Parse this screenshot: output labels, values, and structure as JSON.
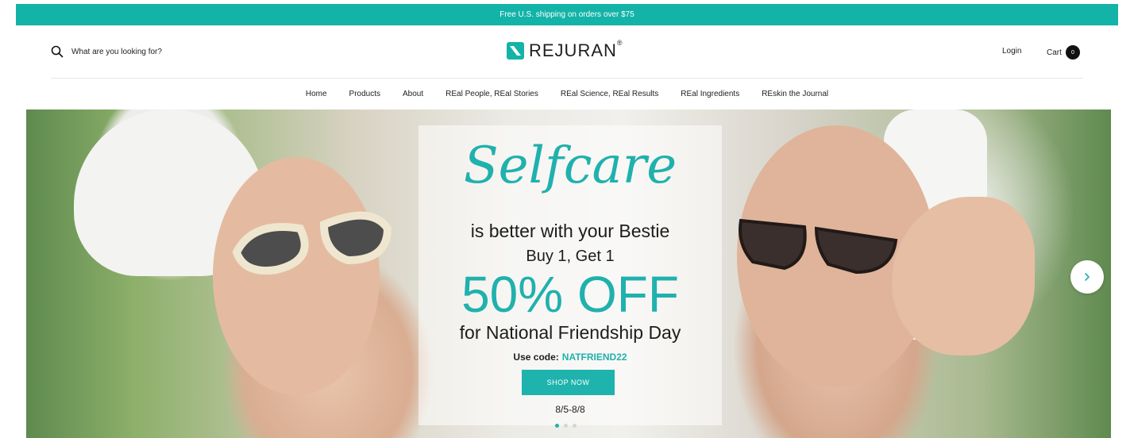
{
  "announcement": {
    "text": "Free U.S. shipping on orders over $75"
  },
  "header": {
    "search_placeholder": "What are you looking for?",
    "logo_text": "REJURAN",
    "logo_reg": "®",
    "login_label": "Login",
    "cart_label": "Cart",
    "cart_count": "0"
  },
  "nav": {
    "items": [
      {
        "label": "Home"
      },
      {
        "label": "Products"
      },
      {
        "label": "About"
      },
      {
        "label": "REal People, REal Stories"
      },
      {
        "label": "REal Science, REal Results"
      },
      {
        "label": "REal Ingredients"
      },
      {
        "label": "REskin the Journal"
      }
    ]
  },
  "hero": {
    "script_title": "Selfcare",
    "line1": "is better with your Bestie",
    "line2": "Buy 1, Get 1",
    "discount": "50% OFF",
    "line3": "for National Friendship Day",
    "code_label": "Use code:",
    "code_value": "NATFRIEND22",
    "cta_label": "SHOP NOW",
    "dates": "8/5-8/8",
    "slides_total": 3,
    "active_slide": 1
  },
  "colors": {
    "brand_teal": "#13b3a8",
    "accent_teal": "#20b1ad",
    "dark": "#111111"
  },
  "icons": {
    "search": "search-icon",
    "logo": "rejuran-logo-icon",
    "next": "chevron-right-icon"
  }
}
